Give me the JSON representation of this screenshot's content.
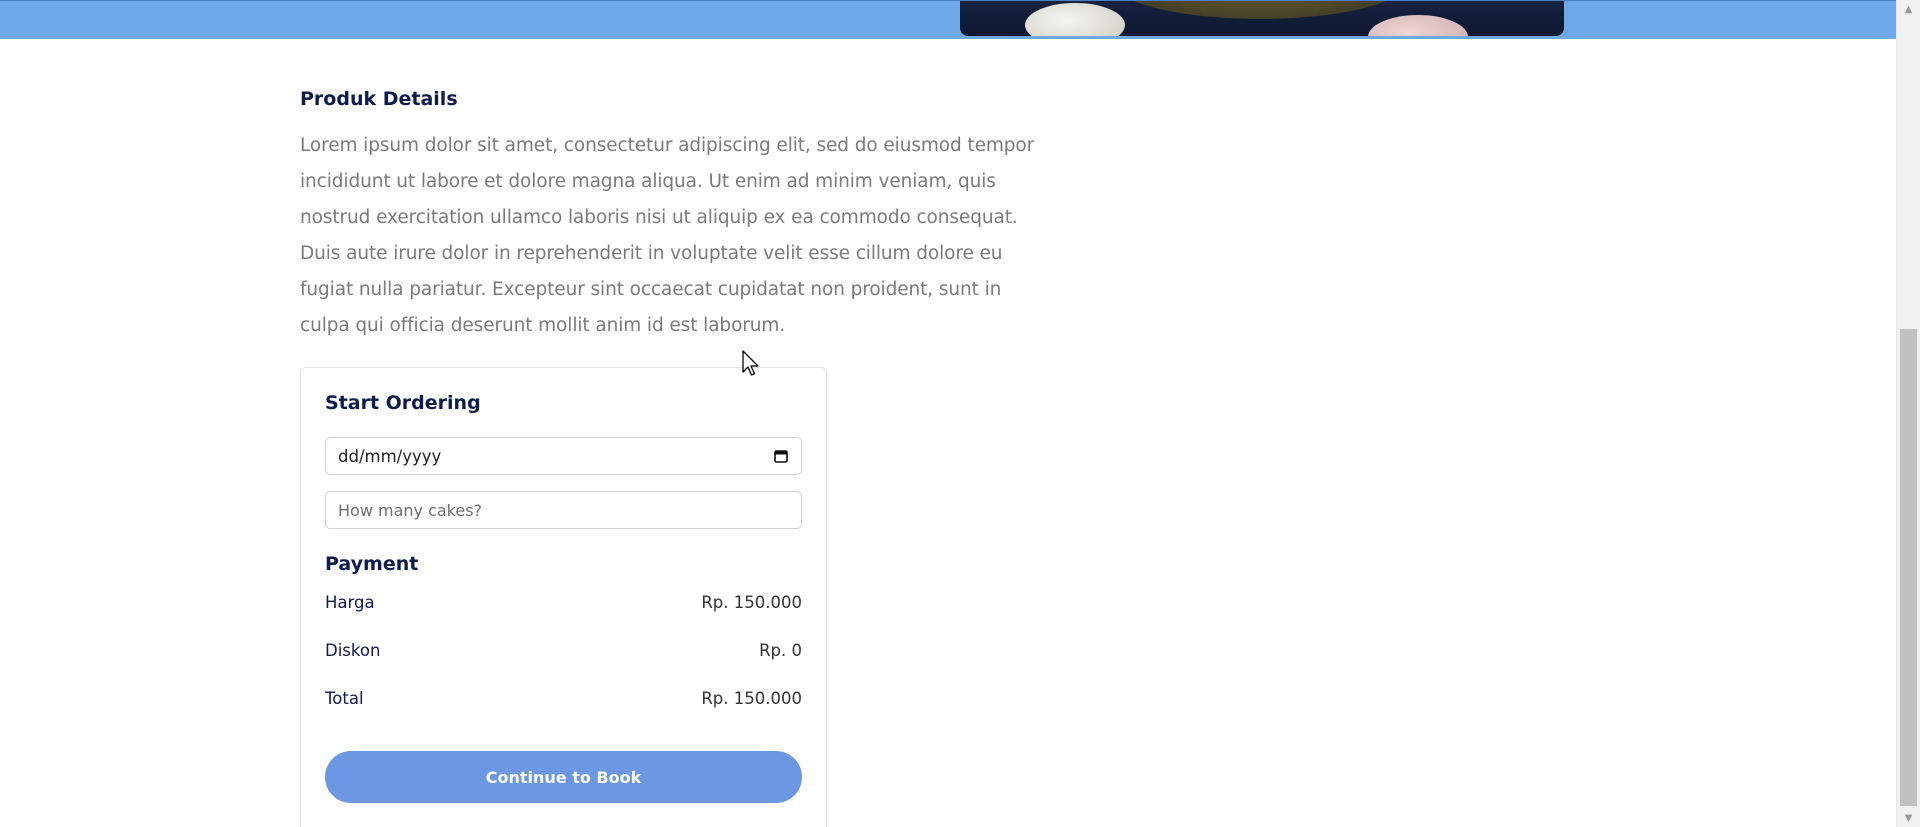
{
  "hero": {
    "image_alt": "cake dessert plate"
  },
  "details": {
    "title": "Produk Details",
    "description": "Lorem ipsum dolor sit amet, consectetur adipiscing elit, sed do eiusmod tempor incididunt ut labore et dolore magna aliqua. Ut enim ad minim veniam, quis nostrud exercitation ullamco laboris nisi ut aliquip ex ea commodo consequat. Duis aute irure dolor in reprehenderit in voluptate velit esse cillum dolore eu fugiat nulla pariatur. Excepteur sint occaecat cupidatat non proident, sunt in culpa qui officia deserunt mollit anim id est laborum."
  },
  "order": {
    "title": "Start Ordering",
    "date_value": "dd/mm/yyyy",
    "date_icon": "calendar-icon",
    "quantity_placeholder": "How many cakes?"
  },
  "payment": {
    "title": "Payment",
    "rows": [
      {
        "label": "Harga",
        "amount": "Rp. 150.000"
      },
      {
        "label": "Diskon",
        "amount": "Rp. 0"
      },
      {
        "label": "Total",
        "amount": "Rp. 150.000"
      }
    ]
  },
  "actions": {
    "book_label": "Continue to Book"
  },
  "colors": {
    "hero_band": "#6fa8e8",
    "heading": "#0d1b4d",
    "body_text": "#7a7a7a",
    "button_bg": "#6b97e3"
  }
}
